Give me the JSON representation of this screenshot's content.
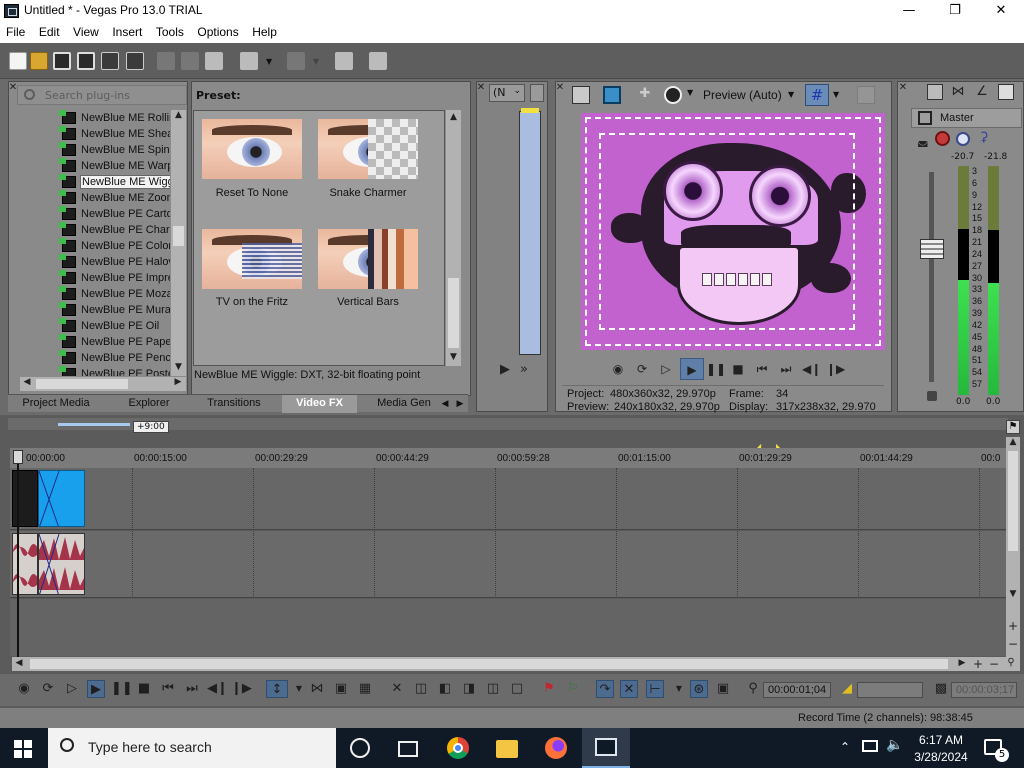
{
  "window": {
    "title": "Untitled * - Vegas Pro 13.0 TRIAL",
    "minimize": "—",
    "maximize": "❐",
    "close": "✕"
  },
  "menu": [
    "File",
    "Edit",
    "View",
    "Insert",
    "Tools",
    "Options",
    "Help"
  ],
  "plugins": {
    "search_placeholder": "Search plug-ins",
    "items": [
      "NewBlue ME Rolling",
      "NewBlue ME Shear",
      "NewBlue ME Spin Bl",
      "NewBlue ME Warp",
      "NewBlue ME Wiggle",
      "NewBlue ME Zoom",
      "NewBlue PE Cartoo",
      "NewBlue PE Charco",
      "NewBlue PE Colore",
      "NewBlue PE Halovi",
      "NewBlue PE Impre",
      "NewBlue PE Mozaic",
      "NewBlue PE Mural",
      "NewBlue PE Oil",
      "NewBlue PE Paper",
      "NewBlue PE Pencil",
      "NewBlue PE Poster"
    ],
    "selected_index": 4
  },
  "presets": {
    "label": "Preset:",
    "items": [
      "Reset To None",
      "Snake Charmer",
      "TV on the Fritz",
      "Vertical Bars"
    ],
    "status": "NewBlue ME Wiggle: DXT, 32-bit floating point"
  },
  "tabs": [
    "Project Media",
    "Explorer",
    "Transitions",
    "Video FX",
    "Media Gen"
  ],
  "active_tab": "Video FX",
  "trimmer": {
    "dropdown": "(N"
  },
  "preview": {
    "quality": "Preview (Auto)",
    "project_label": "Project:",
    "project_value": "480x360x32, 29.970p",
    "preview_label": "Preview:",
    "preview_value": "240x180x32, 29.970p",
    "frame_label": "Frame:",
    "frame_value": "34",
    "display_label": "Display:",
    "display_value": "317x238x32, 29.970"
  },
  "master": {
    "label": "Master",
    "peak_left": "-20.7",
    "peak_right": "-21.8",
    "scale": [
      "3",
      "6",
      "9",
      "12",
      "15",
      "18",
      "21",
      "24",
      "27",
      "30",
      "33",
      "36",
      "39",
      "42",
      "45",
      "48",
      "51",
      "54",
      "57"
    ],
    "bottom_left": "0.0",
    "bottom_right": "0.0",
    "meter_level_left": 0.5,
    "meter_level_right": 0.49
  },
  "timeline": {
    "zoom_marker": "+9:00",
    "ticks": [
      "00:00:00",
      "00:00:15:00",
      "00:00:29:29",
      "00:00:44:29",
      "00:00:59:28",
      "00:01:15:00",
      "00:01:29:29",
      "00:01:44:29",
      "00:0"
    ]
  },
  "transport": {
    "position": "00:00:01;04",
    "end_time": "00:00:03;17"
  },
  "status": {
    "record_time": "Record Time (2 channels): 98:38:45"
  },
  "taskbar": {
    "search_placeholder": "Type here to search",
    "time": "6:17 AM",
    "date": "3/28/2024",
    "notifications": "5"
  }
}
